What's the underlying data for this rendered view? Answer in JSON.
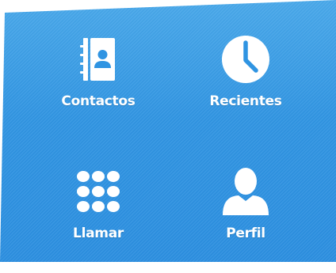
{
  "menu": {
    "items": [
      {
        "label": "Contactos",
        "icon": "contacts-book-icon"
      },
      {
        "label": "Recientes",
        "icon": "clock-icon"
      },
      {
        "label": "Llamar",
        "icon": "dialpad-icon"
      },
      {
        "label": "Perfil",
        "icon": "person-icon"
      }
    ]
  },
  "colors": {
    "background": "#2f94e2",
    "icon": "#ffffff",
    "label": "#ffffff"
  }
}
